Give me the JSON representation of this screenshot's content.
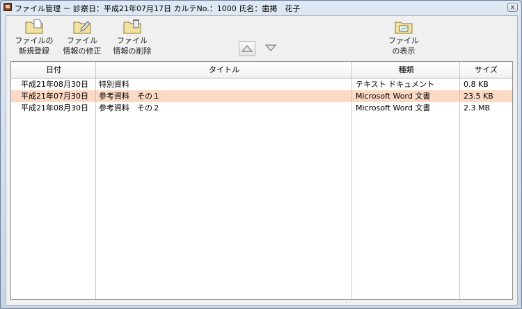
{
  "window": {
    "title": "ファイル管理 － 診察日：平成21年07月17日 カルテNo.：1000 氏名：歯掲　花子",
    "close_glyph": "x"
  },
  "toolbar": {
    "register": {
      "line1": "ファイルの",
      "line2": "新規登録",
      "icon": "folder-new-icon"
    },
    "edit": {
      "line1": "ファイル",
      "line2": "情報の修正",
      "icon": "folder-edit-icon"
    },
    "delete": {
      "line1": "ファイル",
      "line2": "情報の削除",
      "icon": "folder-delete-icon"
    },
    "view": {
      "line1": "ファイル",
      "line2": "の表示",
      "icon": "folder-view-icon"
    },
    "move_up": {
      "icon": "triangle-up-icon"
    },
    "move_down": {
      "icon": "triangle-down-icon"
    }
  },
  "table": {
    "columns": [
      "日付",
      "タイトル",
      "種類",
      "サイズ"
    ],
    "rows": [
      {
        "date": "平成21年08月30日",
        "title": "特別資料",
        "type": "テキスト ドキュメント",
        "size": "0.8 KB",
        "selected": false
      },
      {
        "date": "平成21年07月30日",
        "title": "参考資料　その１",
        "type": "Microsoft Word 文書",
        "size": "23.5 KB",
        "selected": true
      },
      {
        "date": "平成21年08月30日",
        "title": "参考資料　その２",
        "type": "Microsoft Word 文書",
        "size": "2.3 MB",
        "selected": false
      }
    ]
  },
  "colors": {
    "selected_row": "#fcd9c4",
    "folder_fill": "#f3e3a0",
    "folder_stroke": "#8a7a3a"
  }
}
